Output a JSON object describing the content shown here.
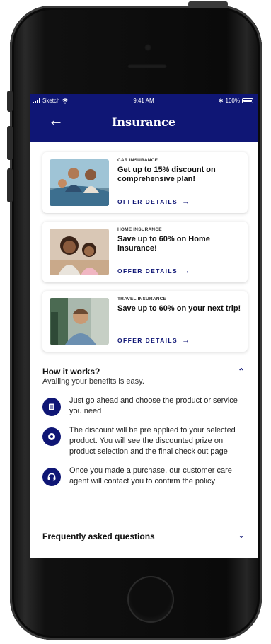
{
  "status_bar": {
    "carrier": "Sketch",
    "time": "9:41 AM",
    "battery": "100%"
  },
  "header": {
    "back_icon": "arrow-left-icon",
    "title": "Insurance"
  },
  "offers": [
    {
      "category": "CAR INSURANCE",
      "title": "Get up to 15% discount on comprehensive plan!",
      "link": "OFFER DETAILS",
      "image": "family-with-car-photo"
    },
    {
      "category": "HOME INSURANCE",
      "title": "Save up to 60% on Home insurance!",
      "link": "OFFER DETAILS",
      "image": "mother-and-child-photo"
    },
    {
      "category": "TRAVEL INSURANCE",
      "title": "Save up to 60% on your next trip!",
      "link": "OFFER DETAILS",
      "image": "traveler-photo"
    }
  ],
  "how_it_works": {
    "title": "How it works?",
    "subtitle": "Availing your benefits is easy.",
    "steps": [
      {
        "icon": "product-icon",
        "text": "Just go ahead and choose the product or service you need"
      },
      {
        "icon": "discount-icon",
        "text": "The discount will be pre applied to your selected product. You will see the discounted prize on product selection and the final check out page"
      },
      {
        "icon": "headset-icon",
        "text": "Once you made a purchase, our customer care agent will contact you to confirm the policy"
      }
    ]
  },
  "faq": {
    "title": "Frequently asked questions"
  },
  "colors": {
    "primary": "#0f1675",
    "background": "#ffffff",
    "text": "#111111"
  }
}
